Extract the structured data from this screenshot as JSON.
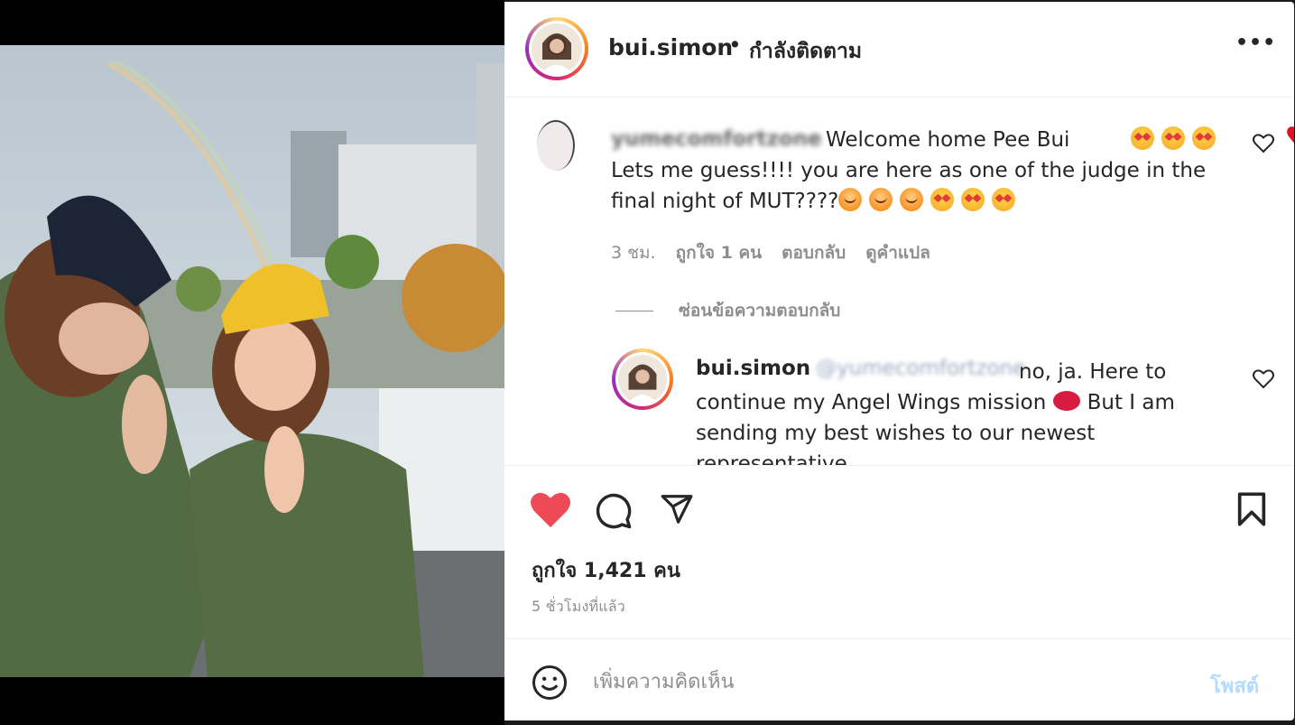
{
  "post": {
    "author": "bui.simon",
    "separator": "•",
    "follow_status": "กำลังติดตาม",
    "more_label": "•••"
  },
  "comments": [
    {
      "user": "yumecomfortzone",
      "text": "Welcome home Pee Bui",
      "text2": "Lets me guess!!!! you are here as one of the judge in the final night of MUT????",
      "time": "3 ชม.",
      "likes": "ถูกใจ 1 คน",
      "reply_label": "ตอบกลับ",
      "translate_label": "ดูคำแปล"
    }
  ],
  "hide_replies_label": "ซ่อนข้อความตอบกลับ",
  "reply": {
    "user": "bui.simon",
    "mention": "@yumecomfortzone",
    "text": "no, ja. Here to continue my Angel Wings mission",
    "text2": "But I am sending my best wishes to our newest representative"
  },
  "likes_count": "ถูกใจ 1,421 คน",
  "posted_ago": "5 ชั่วโมงที่แล้ว",
  "add_comment": {
    "placeholder": "เพิ่มความคิดเห็น",
    "post_label": "โพสต์"
  },
  "colors": {
    "liked_heart": "#ed4956",
    "post_disabled": "#b3dbff",
    "muted": "#8e8e8e"
  }
}
